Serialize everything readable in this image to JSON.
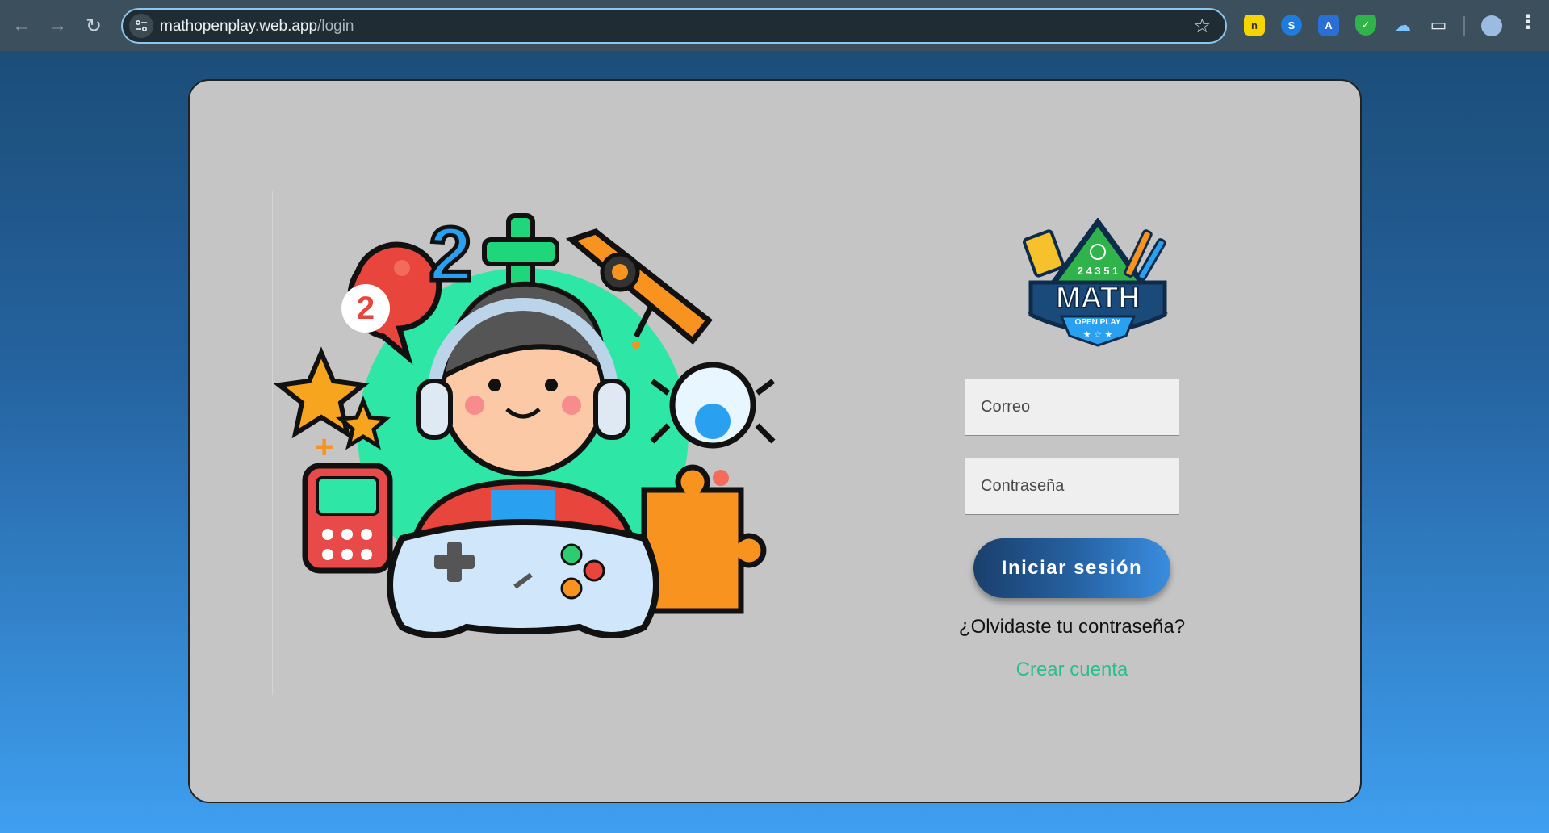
{
  "browser": {
    "url_host": "mathopenplay.web.app",
    "url_path": "/login",
    "back_icon": "arrow-left-icon",
    "forward_icon": "arrow-right-icon",
    "reload_icon": "reload-icon",
    "bookmark_icon": "star-icon",
    "extensions": [
      "note-extension-icon",
      "shazam-extension-icon",
      "translate-extension-icon",
      "shield-extension-icon",
      "weather-extension-icon",
      "puzzle-extensions-icon"
    ],
    "menu_icon": "kebab-menu-icon"
  },
  "logo": {
    "main_text": "MATH",
    "sub_text": "OPEN PLAY",
    "numbers": "2 4 3 5 1"
  },
  "illustration": {
    "number_badge": "2",
    "top_number": "2",
    "description_icons": [
      "kid-gamer",
      "gamepad",
      "calculator",
      "puzzle-piece",
      "star",
      "telescope",
      "plus"
    ]
  },
  "form": {
    "email_placeholder": "Correo",
    "password_placeholder": "Contraseña",
    "login_button": "Iniciar sesión",
    "forgot_link": "¿Olvidaste tu contraseña?",
    "create_link": "Crear cuenta"
  },
  "colors": {
    "accent_green": "#27bf8e",
    "button_dark": "#1a3f6c",
    "button_light": "#3a8de0",
    "card_bg": "#c5c5c5"
  }
}
